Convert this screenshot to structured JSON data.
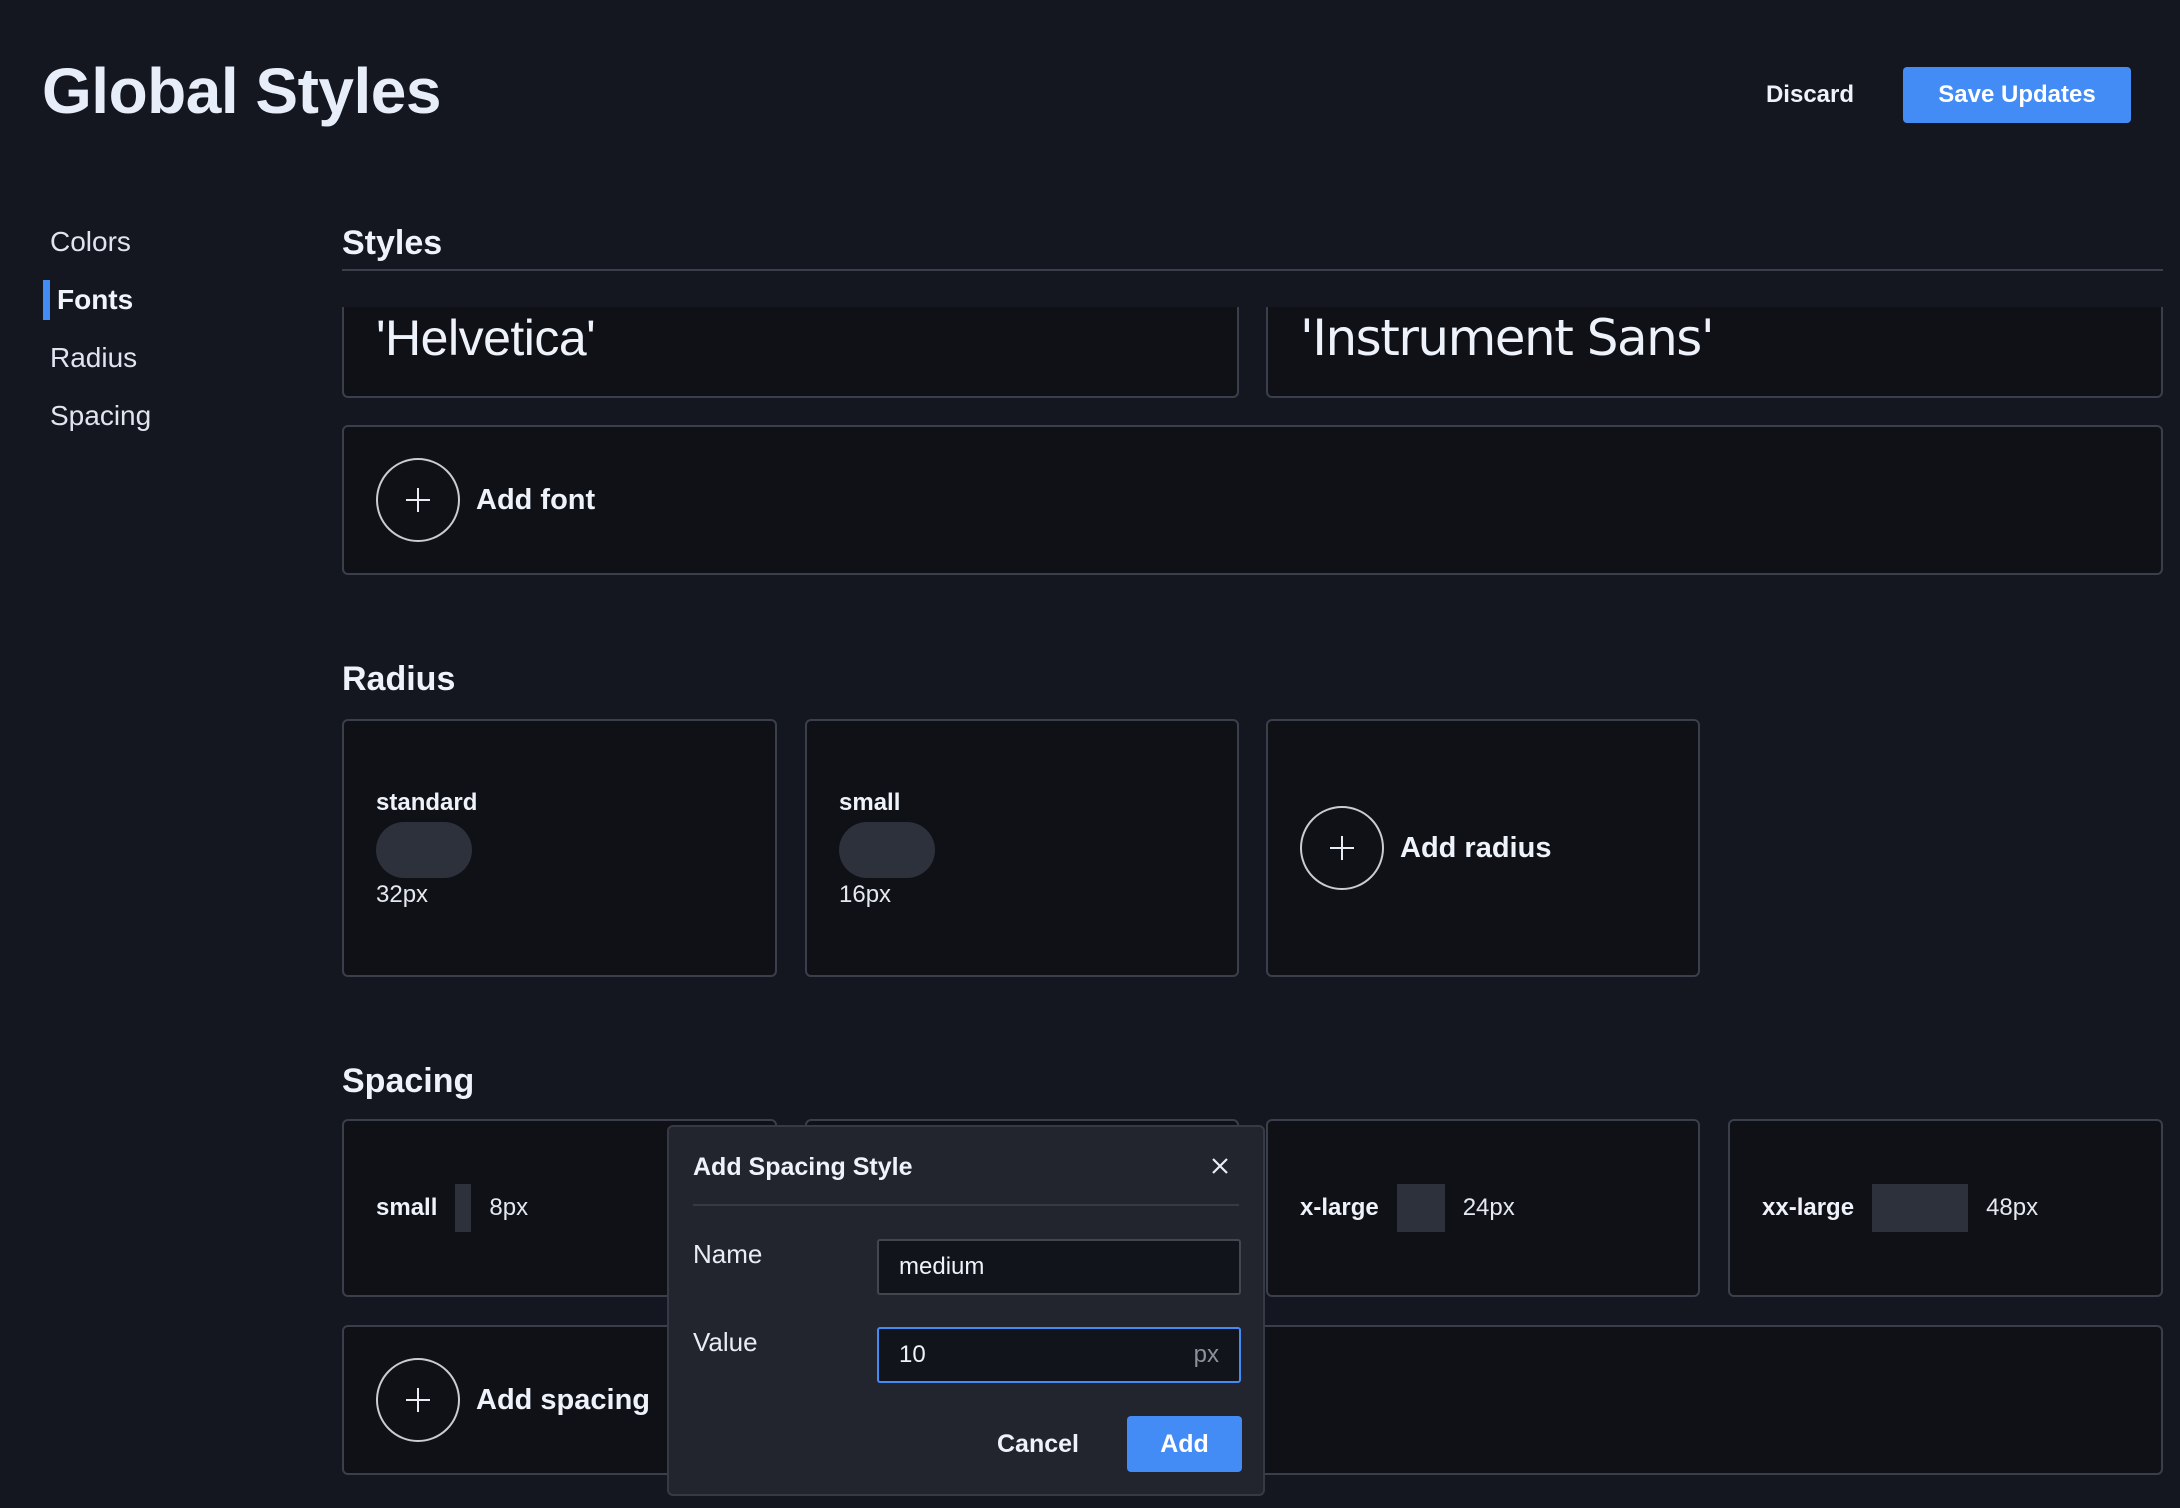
{
  "header": {
    "title": "Global Styles",
    "discard_label": "Discard",
    "save_label": "Save Updates"
  },
  "sidebar": {
    "items": [
      {
        "label": "Colors",
        "active": false
      },
      {
        "label": "Fonts",
        "active": true
      },
      {
        "label": "Radius",
        "active": false
      },
      {
        "label": "Spacing",
        "active": false
      }
    ]
  },
  "styles": {
    "heading": "Styles",
    "fonts": [
      {
        "name": "'Helvetica'"
      },
      {
        "name": "'Instrument Sans'"
      }
    ],
    "add_font_label": "Add font"
  },
  "radius": {
    "heading": "Radius",
    "items": [
      {
        "name": "standard",
        "value": "32px"
      },
      {
        "name": "small",
        "value": "16px"
      }
    ],
    "add_label": "Add radius"
  },
  "spacing": {
    "heading": "Spacing",
    "items": [
      {
        "name": "small",
        "value": "8px"
      },
      {
        "name": "",
        "value": ""
      },
      {
        "name": "x-large",
        "value": "24px"
      },
      {
        "name": "xx-large",
        "value": "48px"
      }
    ],
    "add_label": "Add spacing"
  },
  "dialog": {
    "title": "Add Spacing Style",
    "name_label": "Name",
    "name_value": "medium",
    "value_label": "Value",
    "value_value": "10",
    "value_suffix": "px",
    "cancel_label": "Cancel",
    "add_label": "Add"
  },
  "colors": {
    "accent": "#438bf5",
    "background": "#141720",
    "card": "#0f1117",
    "dialog": "#22252e"
  }
}
